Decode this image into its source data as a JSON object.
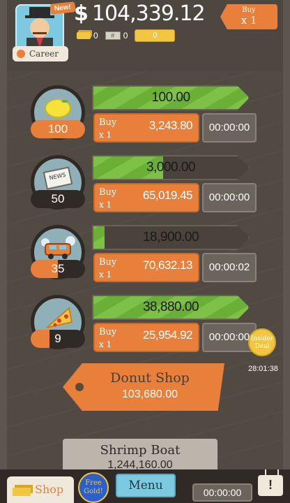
{
  "header": {
    "new_badge": "New!",
    "career_label": "Career",
    "currency_symbol": "$",
    "money": "104,339.12",
    "gold_count": "0",
    "bills_count": "0",
    "bill_symbol": "#",
    "ticket_count": "0",
    "buy_multiplier": {
      "label": "Buy",
      "value": "x 1"
    }
  },
  "businesses": [
    {
      "name": "lemonade",
      "icon": "lemon-icon",
      "count": "100",
      "count_fill": 1.0,
      "revenue": "100.00",
      "revenue_fill": 1.0,
      "buy_label": "Buy",
      "buy_multiplier": "x 1",
      "cost": "3,243.80",
      "timer": "00:00:00"
    },
    {
      "name": "newspaper",
      "icon": "newspaper-icon",
      "count": "50",
      "count_fill": 0.0,
      "revenue": "3,000.00",
      "revenue_fill": 0.45,
      "buy_label": "Buy",
      "buy_multiplier": "x 1",
      "cost": "65,019.45",
      "timer": "00:00:00"
    },
    {
      "name": "car-wash",
      "icon": "car-icon",
      "count": "35",
      "count_fill": 0.5,
      "revenue": "18,900.00",
      "revenue_fill": 0.07,
      "buy_label": "Buy",
      "buy_multiplier": "x 1",
      "cost": "70,632.13",
      "timer": "00:00:02"
    },
    {
      "name": "pizza",
      "icon": "pizza-icon",
      "count": "9",
      "count_fill": 0.35,
      "revenue": "38,880.00",
      "revenue_fill": 1.0,
      "buy_label": "Buy",
      "buy_multiplier": "x 1",
      "cost": "25,954.92",
      "timer": "00:00:00"
    }
  ],
  "insider_deal": {
    "label_line1": "Insider",
    "label_line2": "Deal",
    "timer": "28:01:38"
  },
  "locked": [
    {
      "name": "Donut Shop",
      "price": "103,680.00"
    },
    {
      "name": "Shrimp Boat",
      "price": "1,244,160.00"
    }
  ],
  "bottom": {
    "shop_label": "Shop",
    "free_gold_line1": "Free",
    "free_gold_line2": "Gold!",
    "menu_label": "Menu",
    "timer": "00:00:00",
    "tv_glyph": "!"
  },
  "colors": {
    "accent": "#e8803c",
    "progress_green": "#7dc246",
    "background": "#514a43"
  }
}
